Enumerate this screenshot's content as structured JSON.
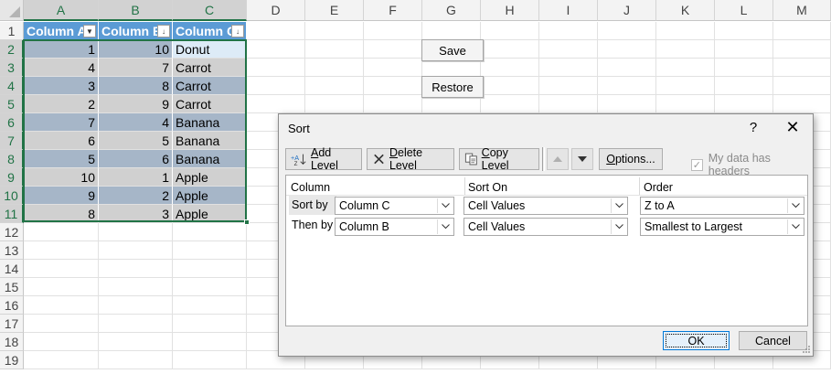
{
  "sheet": {
    "columns": [
      "A",
      "B",
      "C",
      "D",
      "E",
      "F",
      "G",
      "H",
      "I",
      "J",
      "K",
      "L",
      "M"
    ],
    "rows": [
      "1",
      "2",
      "3",
      "4",
      "5",
      "6",
      "7",
      "8",
      "9",
      "10",
      "11",
      "12",
      "13",
      "14",
      "15",
      "16",
      "17",
      "18",
      "19"
    ],
    "table_headers": [
      "Column A",
      "Column B",
      "Column C"
    ],
    "table_rows": [
      [
        "1",
        "10",
        "Donut"
      ],
      [
        "4",
        "7",
        "Carrot"
      ],
      [
        "3",
        "8",
        "Carrot"
      ],
      [
        "2",
        "9",
        "Carrot"
      ],
      [
        "7",
        "4",
        "Banana"
      ],
      [
        "6",
        "5",
        "Banana"
      ],
      [
        "5",
        "6",
        "Banana"
      ],
      [
        "10",
        "1",
        "Apple"
      ],
      [
        "9",
        "2",
        "Apple"
      ],
      [
        "8",
        "3",
        "Apple"
      ]
    ],
    "save_button": "Save",
    "restore_button": "Restore",
    "colors": {
      "header_blue": "#5b9bd5",
      "band": "#a6b6c8",
      "selection_green": "#217346"
    }
  },
  "dialog": {
    "title": "Sort",
    "help": "?",
    "close": "✕",
    "add_level": {
      "pre": "",
      "key": "A",
      "post": "dd Level"
    },
    "delete_level": {
      "pre": "",
      "key": "D",
      "post": "elete Level"
    },
    "copy_level": {
      "pre": "",
      "key": "C",
      "post": "opy Level"
    },
    "options": {
      "pre": "",
      "key": "O",
      "post": "ptions..."
    },
    "headers_checkbox": {
      "pre": "My data has ",
      "key": "h",
      "post": "eaders",
      "checked": true
    },
    "list_headers": {
      "column": "Column",
      "sort_on": "Sort On",
      "order": "Order"
    },
    "levels": [
      {
        "label": "Sort by",
        "column": "Column C",
        "sort_on": "Cell Values",
        "order": "Z to A"
      },
      {
        "label": "Then by",
        "column": "Column B",
        "sort_on": "Cell Values",
        "order": "Smallest to Largest"
      }
    ],
    "ok": "OK",
    "cancel": "Cancel"
  }
}
